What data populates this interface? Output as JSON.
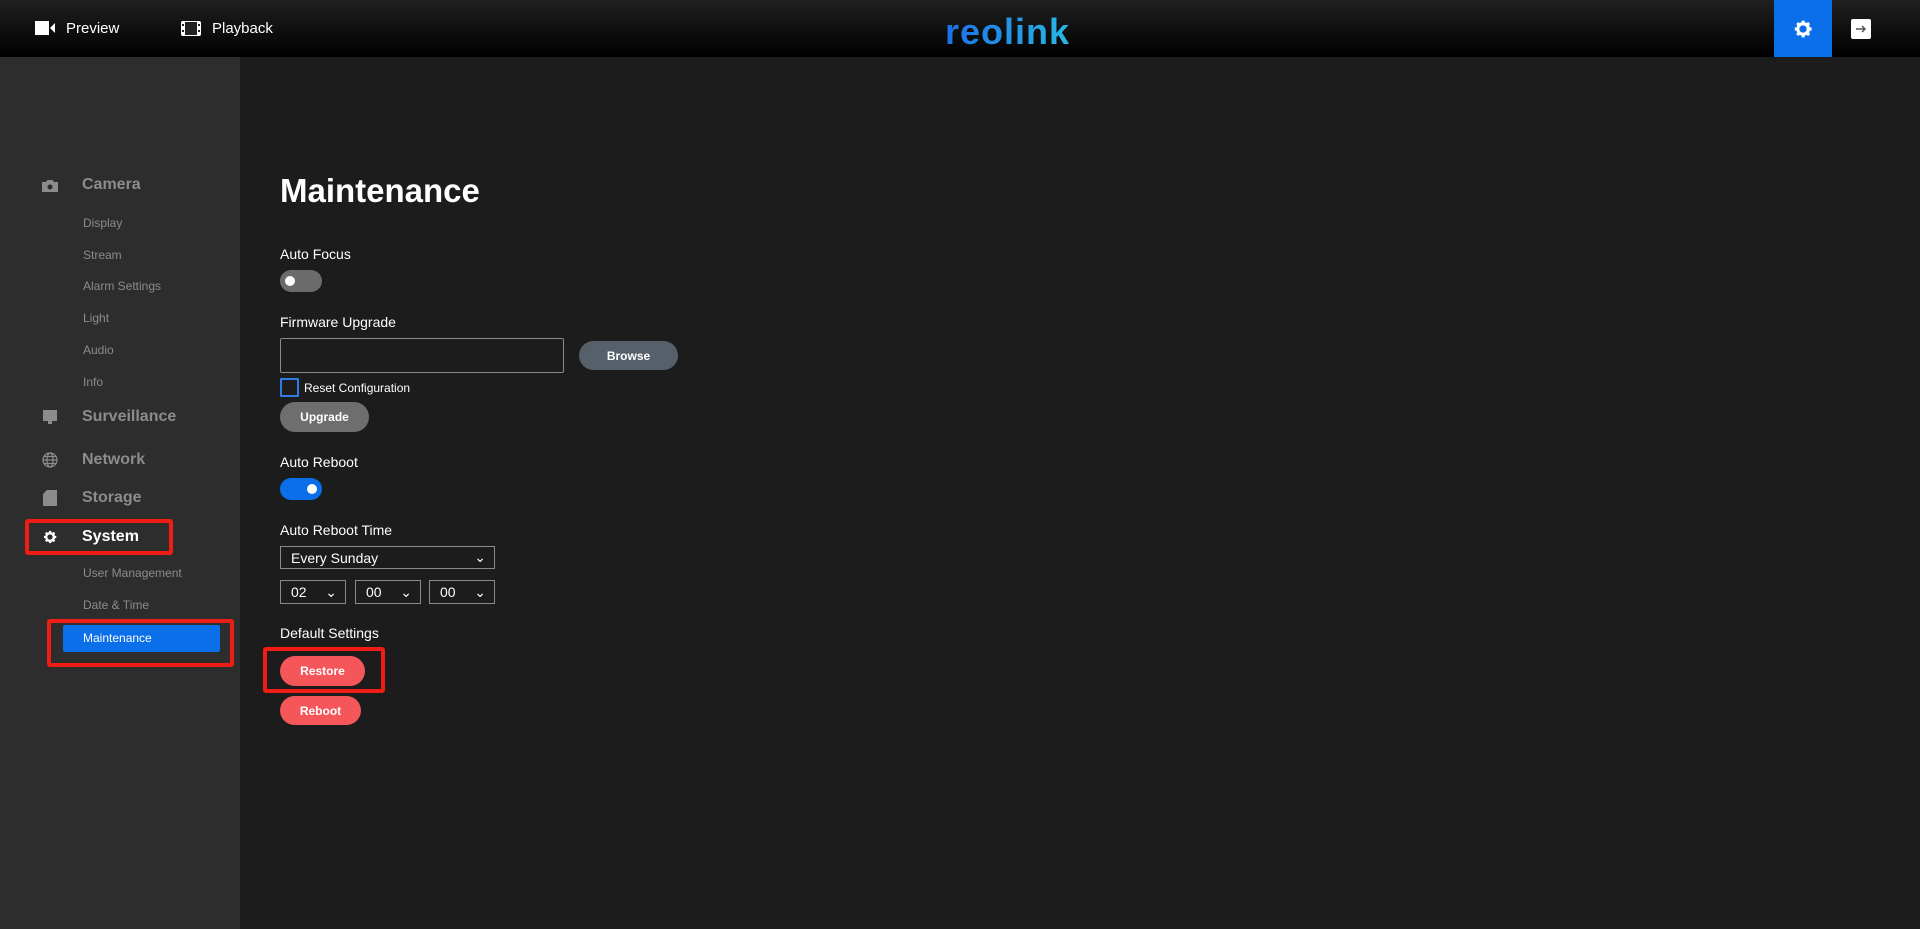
{
  "header": {
    "nav": [
      {
        "label": "Preview",
        "icon": "video-camera-icon"
      },
      {
        "label": "Playback",
        "icon": "film-icon"
      }
    ],
    "logo": "reolink",
    "settings_icon": "gear-icon",
    "logout_icon": "logout-icon"
  },
  "sidebar": {
    "camera": {
      "label": "Camera",
      "items": [
        "Display",
        "Stream",
        "Alarm Settings",
        "Light",
        "Audio",
        "Info"
      ]
    },
    "surveillance": "Surveillance",
    "network": "Network",
    "storage": "Storage",
    "system": {
      "label": "System",
      "items": [
        "User Management",
        "Date & Time",
        "Maintenance"
      ]
    }
  },
  "main": {
    "title": "Maintenance",
    "auto_focus": {
      "label": "Auto Focus",
      "on": false
    },
    "firmware": {
      "label": "Firmware Upgrade",
      "file_value": "",
      "browse": "Browse",
      "reset_label": "Reset Configuration",
      "reset_checked": false,
      "upgrade": "Upgrade"
    },
    "auto_reboot": {
      "label": "Auto Reboot",
      "on": true
    },
    "reboot_time": {
      "label": "Auto Reboot Time",
      "day": "Every Sunday",
      "hour": "02",
      "minute": "00",
      "second": "00"
    },
    "default_settings": {
      "label": "Default Settings",
      "restore": "Restore",
      "reboot": "Reboot"
    }
  },
  "colors": {
    "accent": "#0a6fe8",
    "danger": "#f5565a",
    "highlight": "#f01d16"
  }
}
